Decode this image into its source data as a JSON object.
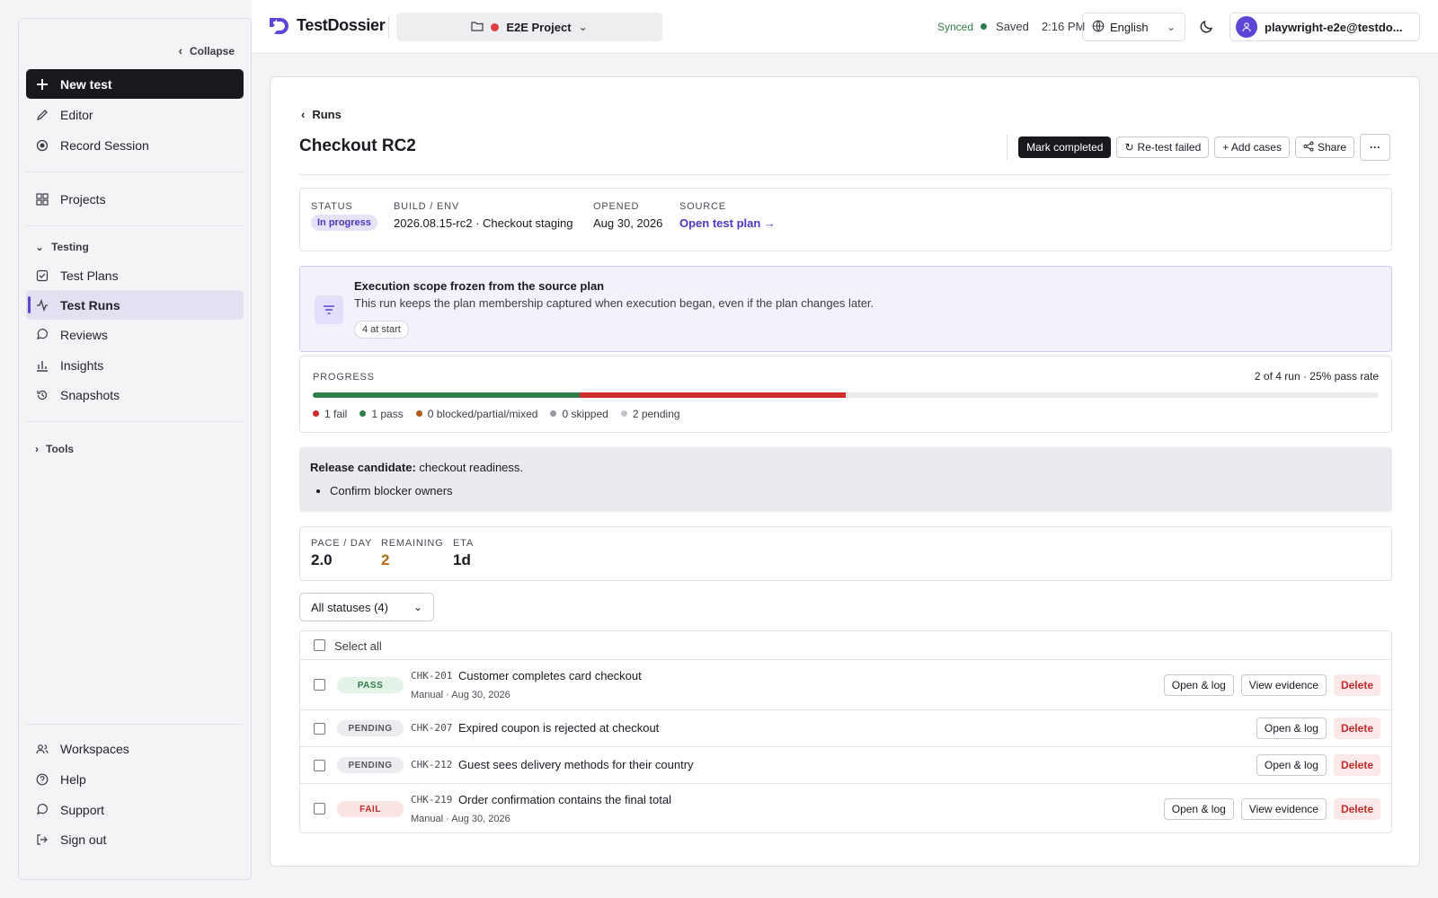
{
  "sidebar": {
    "collapse_label": "Collapse",
    "new_test": "New test",
    "editor": "Editor",
    "record_session": "Record Session",
    "projects": "Projects",
    "testing_section": "Testing",
    "test_plans": "Test Plans",
    "test_runs": "Test Runs",
    "reviews": "Reviews",
    "insights": "Insights",
    "snapshots": "Snapshots",
    "tools_section": "Tools",
    "workspaces": "Workspaces",
    "help": "Help",
    "support": "Support",
    "sign_out": "Sign out"
  },
  "topbar": {
    "app_name": "TestDossier",
    "project": "E2E Project",
    "sync_status": "Synced",
    "save_status": "Saved",
    "time": "2:16 PM",
    "language": "English",
    "user": "playwright-e2e@testdo..."
  },
  "run": {
    "back_label": "Runs",
    "title": "Checkout RC2",
    "actions": {
      "mark_completed": "Mark completed",
      "retest_failed": "Re-test failed",
      "add_cases": "+ Add cases",
      "share": "Share"
    },
    "meta": {
      "status_label": "STATUS",
      "status_value": "In progress",
      "build_label": "BUILD / ENV",
      "build_value": "2026.08.15-rc2 · Checkout staging",
      "opened_label": "OPENED",
      "opened_value": "Aug 30, 2026",
      "source_label": "SOURCE",
      "source_value": "Open test plan →"
    },
    "scope": {
      "title": "Execution scope frozen from the source plan",
      "description": "This run keeps the plan membership captured when execution began, even if the plan changes later.",
      "chip": "4 at start"
    },
    "progress": {
      "label": "PROGRESS",
      "summary": "2 of 4 run · 25% pass rate",
      "pass_fraction": 0.25,
      "fail_fraction": 0.25,
      "legend": {
        "fail": "1 fail",
        "pass": "1 pass",
        "blocked": "0 blocked/partial/mixed",
        "skipped": "0 skipped",
        "pending": "2 pending"
      }
    },
    "notes": {
      "bold": "Release candidate:",
      "text": " checkout readiness.",
      "bullet": "Confirm blocker owners"
    },
    "pace": {
      "pace_label": "PACE / DAY",
      "pace_value": "2.0",
      "remaining_label": "REMAINING",
      "remaining_value": "2",
      "eta_label": "ETA",
      "eta_value": "1d"
    },
    "filter": "All statuses (4)",
    "select_all": "Select all",
    "cases": [
      {
        "status": "PASS",
        "id": "CHK-201",
        "name": "Customer completes card checkout",
        "sub": "Manual · Aug 30, 2026",
        "open": "Open & log",
        "evidence": "View evidence",
        "delete": "Delete"
      },
      {
        "status": "PENDING",
        "id": "CHK-207",
        "name": "Expired coupon is rejected at checkout",
        "open": "Open & log",
        "delete": "Delete"
      },
      {
        "status": "PENDING",
        "id": "CHK-212",
        "name": "Guest sees delivery methods for their country",
        "open": "Open & log",
        "delete": "Delete"
      },
      {
        "status": "FAIL",
        "id": "CHK-219",
        "name": "Order confirmation contains the final total",
        "sub": "Manual · Aug 30, 2026",
        "open": "Open & log",
        "evidence": "View evidence",
        "delete": "Delete"
      }
    ]
  },
  "colors": {
    "accent": "#5b46d6",
    "pass": "#2f7d4a",
    "fail": "#d02c2c",
    "blocked": "#b35a12",
    "skipped": "#9a9aa2",
    "pending": "#c4c4ca",
    "remaining": "#b36b12"
  }
}
